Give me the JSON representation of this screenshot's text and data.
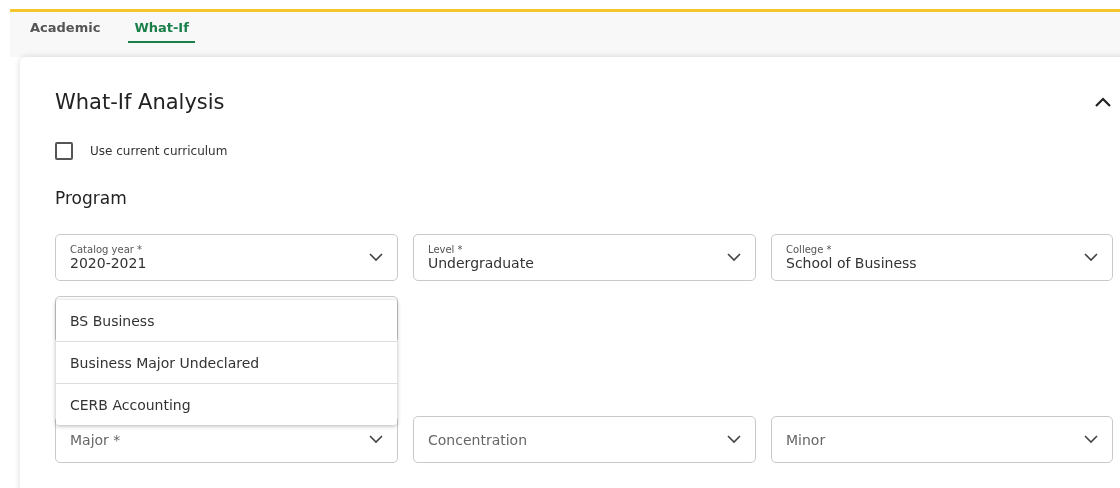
{
  "tabs": [
    {
      "label": "Academic",
      "selected": false
    },
    {
      "label": "What-If",
      "selected": true
    }
  ],
  "panel": {
    "title": "What-If Analysis",
    "expanded": true,
    "checkbox": {
      "label": "Use current curriculum",
      "checked": false
    },
    "section_title": "Program",
    "fields": [
      {
        "label": "Catalog year *",
        "value": "2020-2021"
      },
      {
        "label": "Level *",
        "value": "Undergraduate"
      },
      {
        "label": "College *",
        "value": "School of Business"
      }
    ],
    "menu_options": [
      {
        "label": "BS Business"
      },
      {
        "label": "Business Major Undeclared"
      },
      {
        "label": "CERB Accounting"
      }
    ],
    "lower_fields": [
      {
        "placeholder": "Major *"
      },
      {
        "placeholder": "Concentration"
      },
      {
        "placeholder": "Minor"
      }
    ]
  }
}
